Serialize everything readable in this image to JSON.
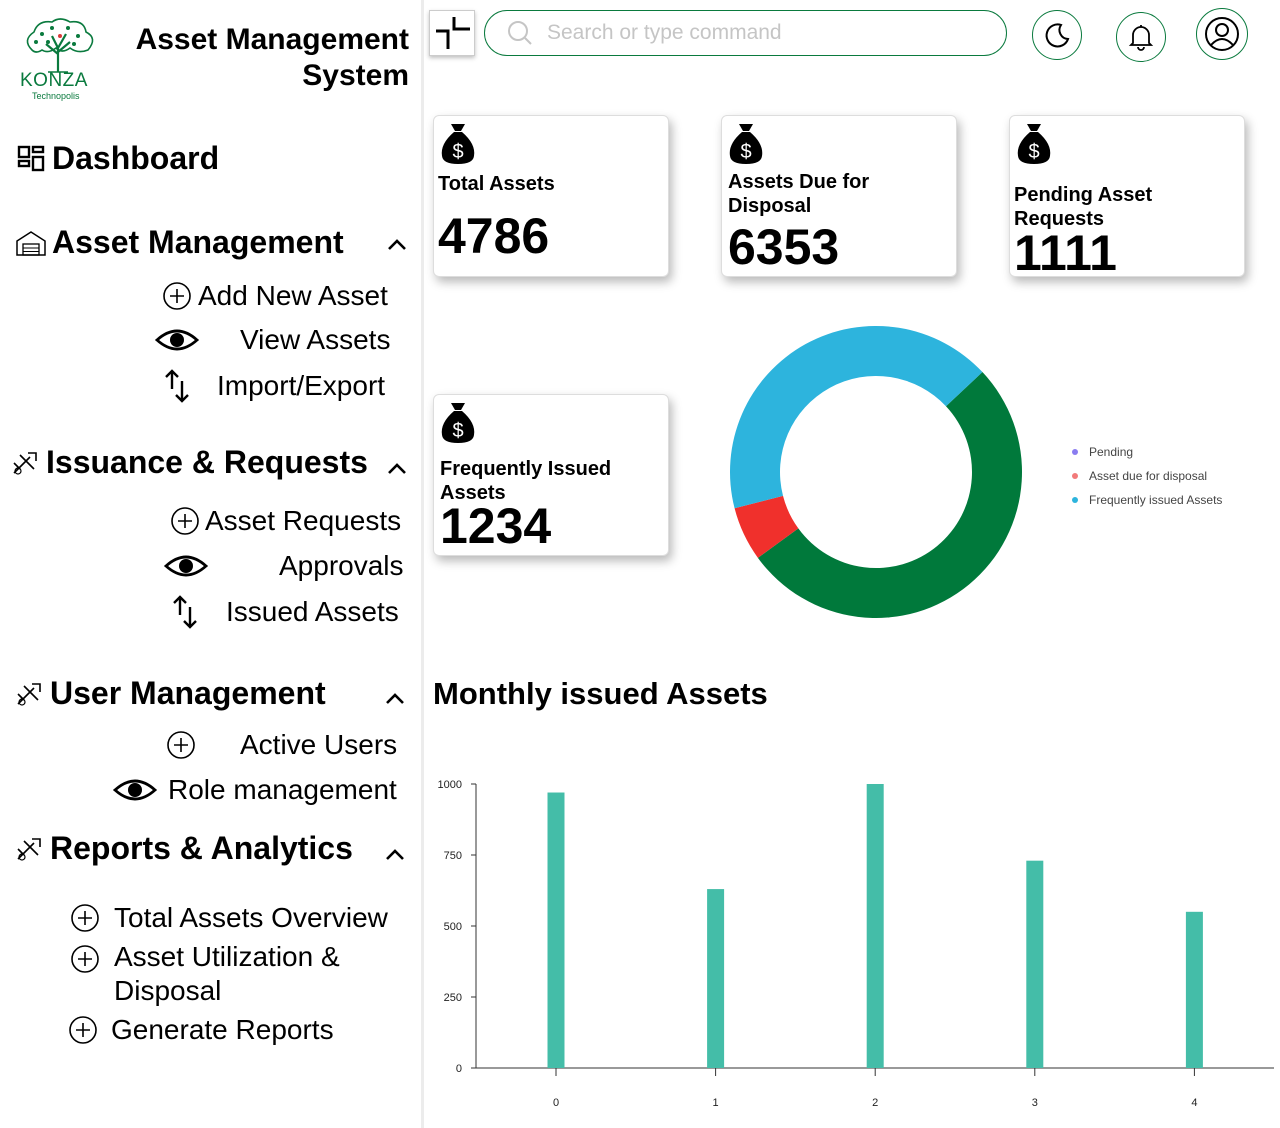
{
  "app": {
    "logo_name": "KONZA",
    "logo_sub": "Technopolis",
    "title": "Asset Management System"
  },
  "sidebar": {
    "dashboard": "Dashboard",
    "sections": [
      {
        "title": "Asset Management",
        "items": [
          "Add New Asset",
          "View Assets",
          "Import/Export"
        ]
      },
      {
        "title": "Issuance & Requests",
        "items": [
          "Asset Requests",
          "Approvals",
          "Issued Assets"
        ]
      },
      {
        "title": "User Management",
        "items": [
          "Active Users",
          "Role management"
        ]
      },
      {
        "title": "Reports & Analytics",
        "items": [
          "Total Assets Overview",
          "Asset Utilization & Disposal",
          "Generate Reports"
        ]
      }
    ]
  },
  "topbar": {
    "search_placeholder": "Search or type command"
  },
  "cards": [
    {
      "title": "Total Assets",
      "value": "4786"
    },
    {
      "title": "Assets Due for Disposal",
      "value": "6353"
    },
    {
      "title": "Pending Asset Requests",
      "value": "1111"
    },
    {
      "title": "Frequently Issued Assets",
      "value": "1234"
    }
  ],
  "colors": {
    "brand": "#0a7a3e",
    "bar": "#44bda8",
    "donut_green": "#00793b",
    "donut_red": "#f0302c",
    "donut_blue": "#2db4dd",
    "legend_pending": "#8a7cf0",
    "legend_disposal": "#f27a7a",
    "legend_frequent": "#2db4dd"
  },
  "chart_data": [
    {
      "type": "pie",
      "title": "",
      "series": [
        {
          "name": "Pending",
          "value": 52,
          "color": "#00793b"
        },
        {
          "name": "Asset due for disposal",
          "value": 6,
          "color": "#f0302c"
        },
        {
          "name": "Frequently issued Assets",
          "value": 42,
          "color": "#2db4dd"
        }
      ],
      "legend_labels": [
        "Pending",
        "Asset due for disposal",
        "Frequently issued Assets"
      ],
      "legend": "right"
    },
    {
      "type": "bar",
      "title": "Monthly issued Assets",
      "categories": [
        "0",
        "1",
        "2",
        "3",
        "4"
      ],
      "values": [
        970,
        630,
        1000,
        730,
        550
      ],
      "yticks": [
        0,
        250,
        500,
        750,
        1000
      ],
      "ylim": [
        0,
        1000
      ],
      "grid": false
    }
  ]
}
